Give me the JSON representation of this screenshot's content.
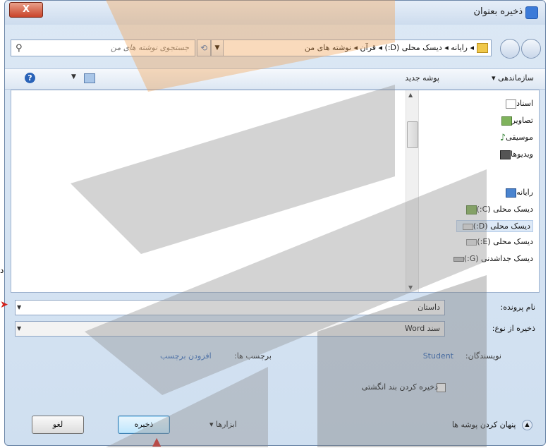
{
  "titlebar": {
    "title": "ذخیره بعنوان",
    "close_label": "X"
  },
  "address": {
    "path": "◂ رایانه ◂ دیسک محلی (D:) ◂ قرآن ◂ نوشته های من",
    "search_placeholder": "جستجوی نوشته های من",
    "refresh_label": "⟲"
  },
  "toolbar": {
    "organize_label": "سازماندهی ▾",
    "new_folder_label": "پوشه جدید",
    "help_label": "?"
  },
  "nav": {
    "items": [
      {
        "label": "اسناد",
        "icon": "documents-icon"
      },
      {
        "label": "تصاویر",
        "icon": "pictures-icon"
      },
      {
        "label": "موسیقی",
        "icon": "music-icon"
      },
      {
        "label": "ویدیوها",
        "icon": "videos-icon"
      },
      {
        "label": "رایانه",
        "icon": "computer-icon"
      },
      {
        "label": "دیسک محلی (C:)",
        "icon": "drive-icon"
      },
      {
        "label": "دیسک محلی (D:)",
        "icon": "drive-icon"
      },
      {
        "label": "دیسک محلی (E:)",
        "icon": "drive-icon"
      },
      {
        "label": "دیسک جداشدنی (G:)",
        "icon": "removable-drive-icon"
      }
    ]
  },
  "form": {
    "filename_label": "نام پرونده:",
    "filename_value": "داستان",
    "savetype_label": "ذخیره از نوع:",
    "savetype_value": "سند Word"
  },
  "meta": {
    "authors_label": "نویسندگان:",
    "authors_value": "Student",
    "tags_label": "برچسب ها:",
    "tags_value": "افزودن برچسب"
  },
  "thumbnail_label": "ذخیره کردن بند انگشتی",
  "footer": {
    "hide_folders_label": "پنهان کردن پوشه ها",
    "tools_label": "ابزارها",
    "save_label": "ذخیره",
    "cancel_label": "لغو"
  },
  "stray_text": "د",
  "colors": {
    "accent": "#3b7ad8",
    "watermark_orange": "#f5a25a",
    "watermark_gray": "#9a9a9a",
    "arrow_red": "#d3231d"
  }
}
